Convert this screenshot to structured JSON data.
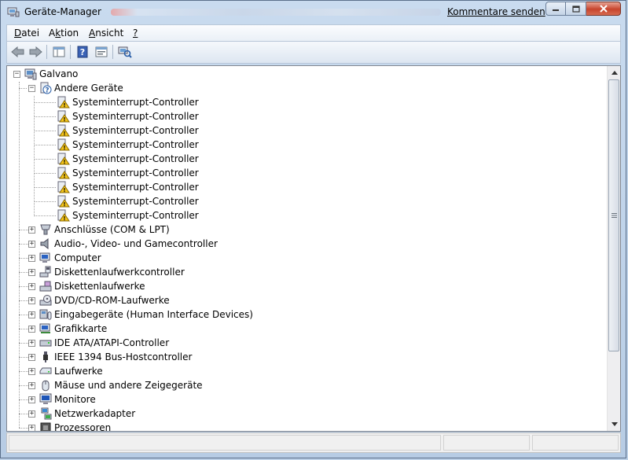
{
  "window": {
    "title": "Geräte-Manager",
    "title_link": "Kommentare senden"
  },
  "menu": [
    {
      "label_pre": "",
      "mnemonic": "D",
      "label_post": "atei"
    },
    {
      "label_pre": "A",
      "mnemonic": "k",
      "label_post": "tion"
    },
    {
      "label_pre": "",
      "mnemonic": "A",
      "label_post": "nsicht"
    },
    {
      "label_pre": "",
      "mnemonic": "?",
      "label_post": ""
    }
  ],
  "toolbar": {
    "icons": [
      "back-arrow-icon",
      "forward-arrow-icon",
      "show-hide-console-tree-icon",
      "help-icon",
      "properties-icon",
      "scan-hardware-icon"
    ]
  },
  "tree": {
    "root": "Galvano",
    "other_devices": "Andere Geräte",
    "unknown_children": [
      "Systeminterrupt-Controller",
      "Systeminterrupt-Controller",
      "Systeminterrupt-Controller",
      "Systeminterrupt-Controller",
      "Systeminterrupt-Controller",
      "Systeminterrupt-Controller",
      "Systeminterrupt-Controller",
      "Systeminterrupt-Controller",
      "Systeminterrupt-Controller"
    ],
    "categories": [
      {
        "label": "Anschlüsse (COM & LPT)",
        "icon": "port-icon"
      },
      {
        "label": "Audio-, Video- und Gamecontroller",
        "icon": "speaker-icon"
      },
      {
        "label": "Computer",
        "icon": "computer-icon"
      },
      {
        "label": "Diskettenlaufwerkcontroller",
        "icon": "floppy-controller-icon"
      },
      {
        "label": "Diskettenlaufwerke",
        "icon": "floppy-drive-icon"
      },
      {
        "label": "DVD/CD-ROM-Laufwerke",
        "icon": "dvd-drive-icon"
      },
      {
        "label": "Eingabegeräte (Human Interface Devices)",
        "icon": "hid-icon"
      },
      {
        "label": "Grafikkarte",
        "icon": "display-adapter-icon"
      },
      {
        "label": "IDE ATA/ATAPI-Controller",
        "icon": "ide-controller-icon"
      },
      {
        "label": "IEEE 1394 Bus-Hostcontroller",
        "icon": "firewire-icon"
      },
      {
        "label": "Laufwerke",
        "icon": "disk-drive-icon"
      },
      {
        "label": "Mäuse und andere Zeigegeräte",
        "icon": "mouse-icon"
      },
      {
        "label": "Monitore",
        "icon": "monitor-icon"
      },
      {
        "label": "Netzwerkadapter",
        "icon": "network-adapter-icon"
      },
      {
        "label": "Prozessoren",
        "icon": "processor-icon"
      }
    ]
  },
  "colors": {
    "titlebar": "#c9dbef",
    "warning": "#f5c518",
    "close_button": "#c7442d"
  }
}
